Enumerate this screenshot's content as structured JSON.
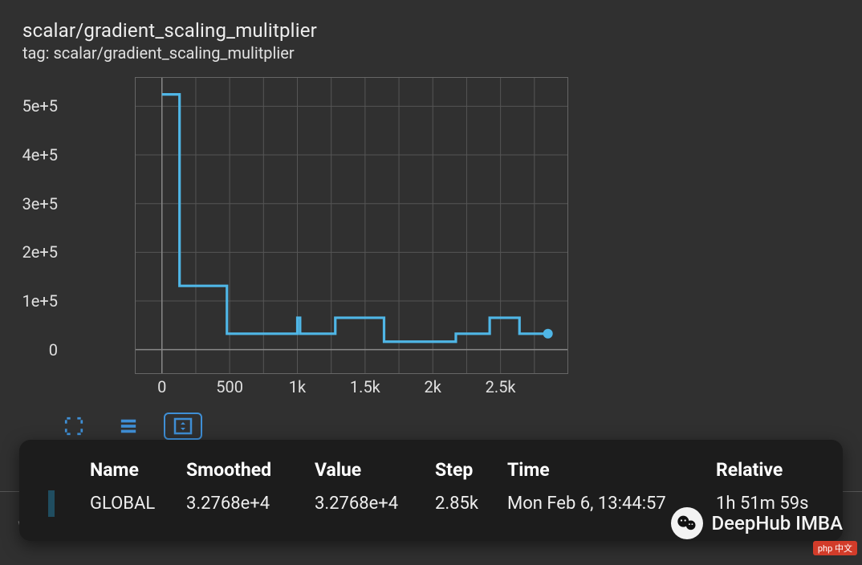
{
  "header": {
    "title": "scalar/gradient_scaling_mulitplier",
    "tag_label": "tag: scalar/gradient_scaling_mulitplier"
  },
  "chart_data": {
    "type": "line",
    "title": "scalar/gradient_scaling_mulitplier",
    "xlabel": "",
    "ylabel": "",
    "xlim": [
      -200,
      3000
    ],
    "ylim": [
      -50000,
      560000
    ],
    "x_ticks": [
      0,
      500,
      1000,
      1500,
      2000,
      2500
    ],
    "x_tick_labels": [
      "0",
      "500",
      "1k",
      "1.5k",
      "2k",
      "2.5k"
    ],
    "y_ticks": [
      0,
      100000,
      200000,
      300000,
      400000,
      500000
    ],
    "y_tick_labels": [
      "0",
      "1e+5",
      "2e+5",
      "3e+5",
      "4e+5",
      "5e+5"
    ],
    "series": [
      {
        "name": "GLOBAL",
        "color": "#4fb6e6",
        "x": [
          0,
          30,
          130,
          350,
          480,
          750,
          1000,
          1020,
          1250,
          1280,
          1600,
          1640,
          2130,
          2170,
          2400,
          2420,
          2600,
          2640,
          2850
        ],
        "values": [
          524288,
          524288,
          131072,
          131072,
          32768,
          32768,
          65536,
          32768,
          32768,
          65536,
          65536,
          16384,
          16384,
          32768,
          32768,
          65536,
          65536,
          32768,
          32768
        ]
      }
    ]
  },
  "toolbar": {
    "icons": [
      "fullscreen-icon",
      "list-icon",
      "fit-icon"
    ],
    "active_index": 2
  },
  "tooltip": {
    "headers": {
      "name": "Name",
      "smoothed": "Smoothed",
      "value": "Value",
      "step": "Step",
      "time": "Time",
      "relative": "Relative"
    },
    "row": {
      "swatch_color": "#29a9df",
      "name": "GLOBAL",
      "smoothed": "3.2768e+4",
      "value": "3.2768e+4",
      "step": "2.85k",
      "time": "Mon Feb 6, 13:44:57",
      "relative": "1h 51m 59s"
    }
  },
  "background_text": "weights",
  "watermark": {
    "label": "DeepHub IMBA"
  },
  "badge_text": "php 中文"
}
